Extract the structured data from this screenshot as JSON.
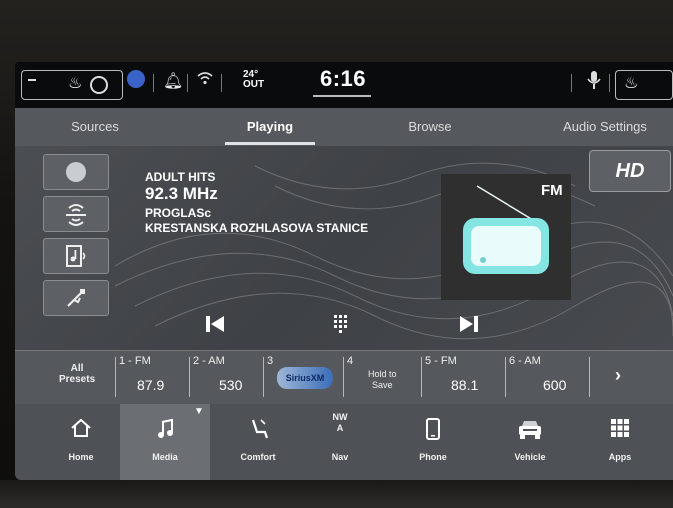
{
  "status": {
    "temperature": "24°",
    "temperature_sub": "OUT",
    "time": "6:16"
  },
  "tabs": [
    {
      "label": "Sources"
    },
    {
      "label": "Playing"
    },
    {
      "label": "Browse"
    },
    {
      "label": "Audio Settings"
    }
  ],
  "now_playing": {
    "station_name": "ADULT HITS",
    "frequency": "92.3 MHz",
    "rds_line1": "PROGLASc",
    "rds_line2": "KRESTANSKA ROZHLASOVA STANICE",
    "band_label": "FM",
    "hd_label": "HD"
  },
  "presets": {
    "all_label_line1": "All",
    "all_label_line2": "Presets",
    "items": [
      {
        "num": "1 - FM",
        "value": "87.9"
      },
      {
        "num": "2 - AM",
        "value": "530"
      },
      {
        "num": "3",
        "value": "SiriusXM"
      },
      {
        "num": "4",
        "hold_line1": "Hold to",
        "hold_line2": "Save"
      },
      {
        "num": "5 - FM",
        "value": "88.1"
      },
      {
        "num": "6 - AM",
        "value": "600"
      }
    ],
    "next": "›"
  },
  "nav": {
    "home": "Home",
    "media": "Media",
    "comfort": "Comfort",
    "compass_line1": "NW",
    "compass_line2": "A",
    "nav": "Nav",
    "phone": "Phone",
    "vehicle": "Vehicle",
    "apps": "Apps"
  },
  "icons": {
    "status_left": [
      "seat-heat-icon",
      "driver-assist-icon",
      "bell-icon",
      "wifi-icon"
    ],
    "status_right": [
      "microphone-icon",
      "passenger-seat-icon"
    ],
    "side_buttons": [
      "radio-source-icon",
      "radio-antenna-icon",
      "music-file-icon",
      "usb-icon"
    ],
    "controls": [
      "previous-icon",
      "keypad-icon",
      "next-icon"
    ]
  },
  "colors": {
    "tab_bar": "#55585c",
    "screen_bg": "#0c0d0f",
    "art_tint": "#7fe3e0"
  }
}
